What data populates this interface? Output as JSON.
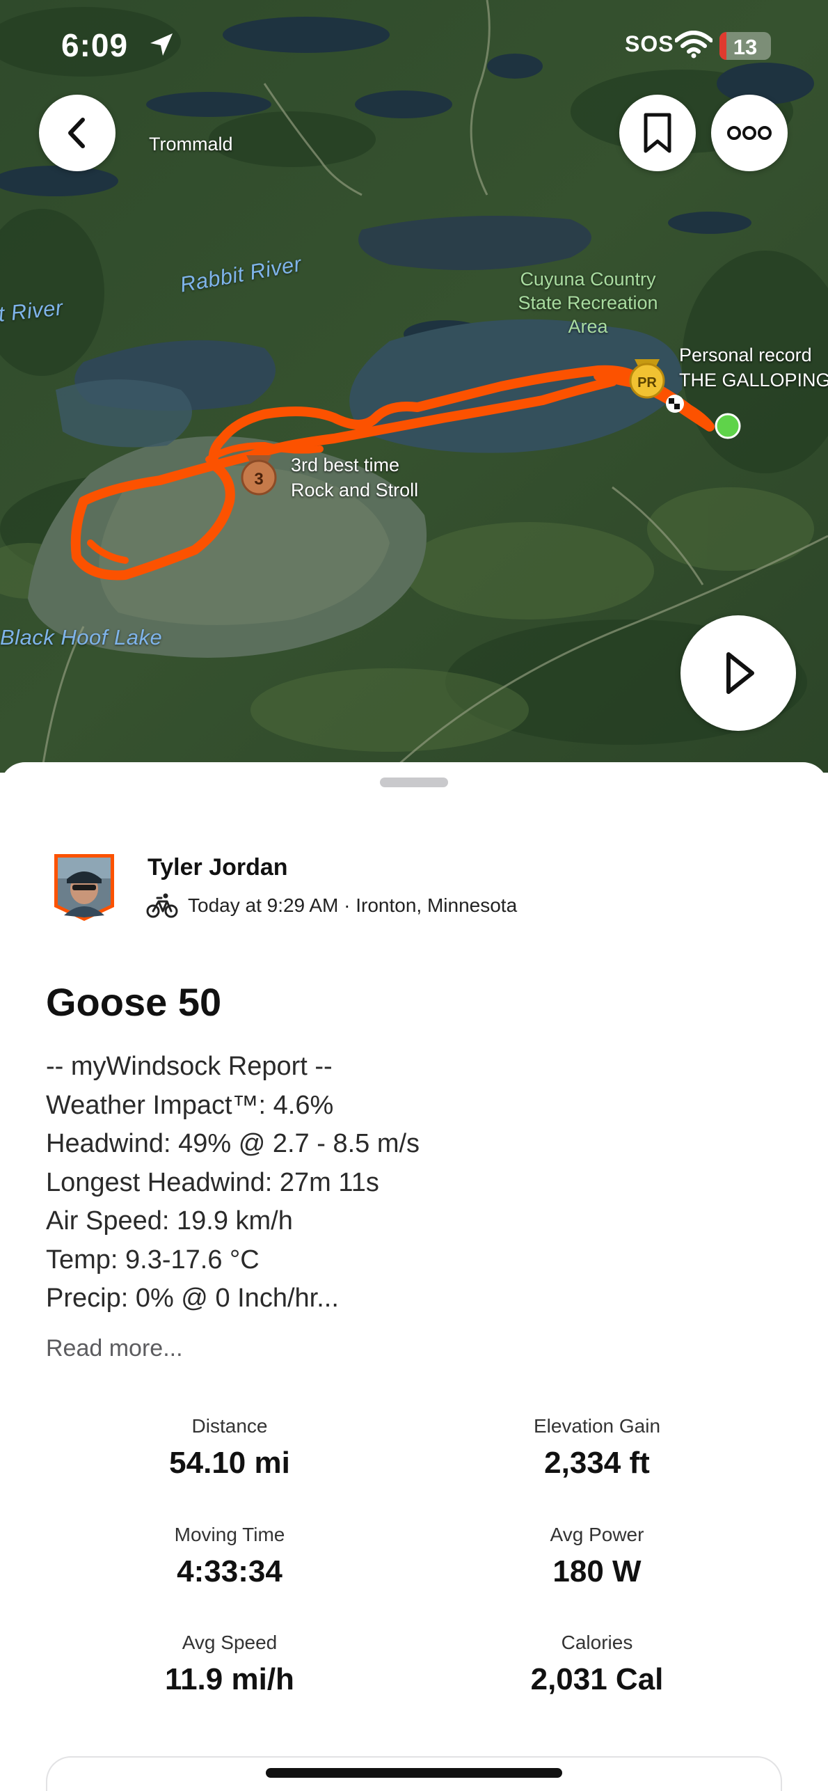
{
  "status_bar": {
    "time": "6:09",
    "sos": "SOS",
    "battery": "13",
    "battery_level_percent": 13
  },
  "map": {
    "labels": {
      "town": "Trommald",
      "rabbit_river": "Rabbit River",
      "river_left": "t River",
      "park": [
        "Cuyuna Country",
        "State Recreation",
        "Area"
      ],
      "lake": "Black Hoof Lake"
    },
    "segments": [
      {
        "badge": "PR",
        "lines": [
          "Personal record",
          "THE GALLOPING"
        ]
      },
      {
        "badge": "3",
        "lines": [
          "3rd best time",
          "Rock and Stroll"
        ]
      }
    ],
    "route_color": "#fc5200",
    "start_marker_color": "#5fd34a"
  },
  "buttons": {
    "back": "back-icon",
    "bookmark": "bookmark-icon",
    "more": "more-icon",
    "play": "play-icon"
  },
  "activity": {
    "athlete": "Tyler Jordan",
    "sport_icon": "bike-icon",
    "meta": "Today at 9:29 AM · Ironton, Minnesota",
    "title": "Goose 50",
    "description": [
      "-- myWindsock Report --",
      "Weather Impact™: 4.6%",
      "Headwind: 49% @ 2.7 - 8.5 m/s",
      "Longest Headwind: 27m 11s",
      "Air Speed: 19.9 km/h",
      "Temp: 9.3-17.6 °C",
      "Precip: 0% @ 0 Inch/hr..."
    ],
    "read_more": "Read more..."
  },
  "stats": [
    {
      "label": "Distance",
      "value": "54.10 mi"
    },
    {
      "label": "Elevation Gain",
      "value": "2,334 ft"
    },
    {
      "label": "Moving Time",
      "value": "4:33:34"
    },
    {
      "label": "Avg Power",
      "value": "180 W"
    },
    {
      "label": "Avg Speed",
      "value": "11.9 mi/h"
    },
    {
      "label": "Calories",
      "value": "2,031 Cal"
    }
  ]
}
